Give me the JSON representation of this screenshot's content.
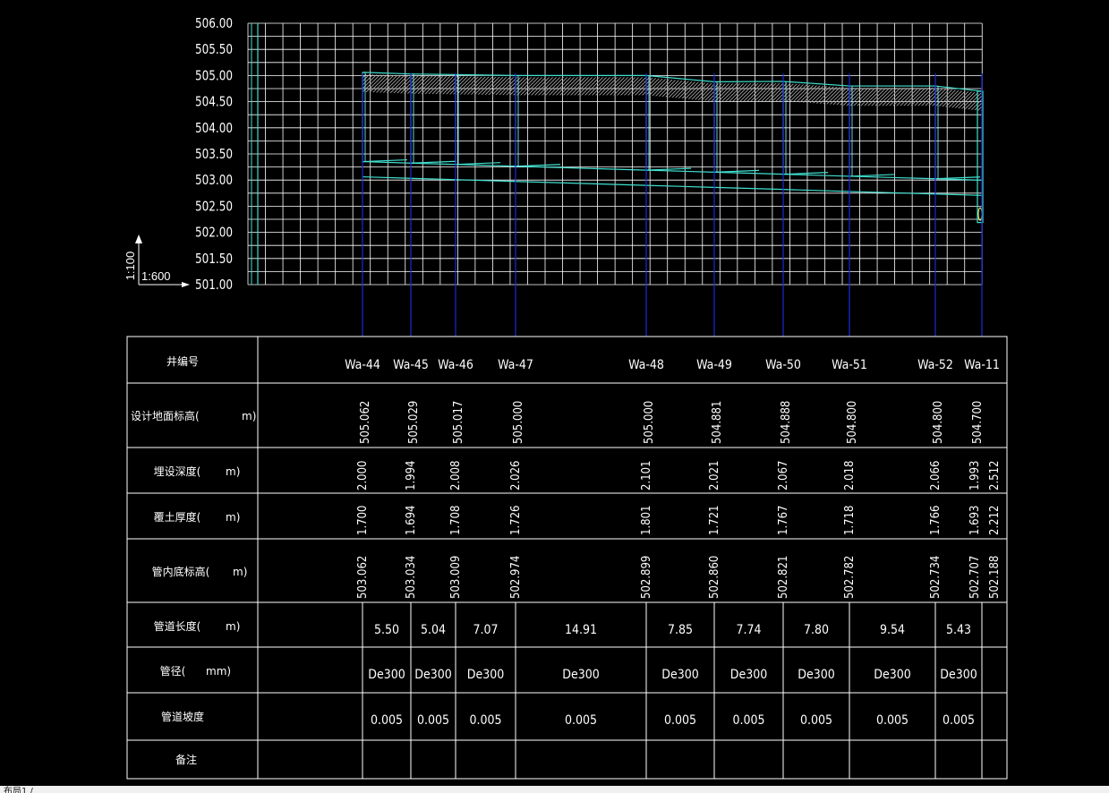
{
  "profile": {
    "y_axis": {
      "min": 501.0,
      "max": 506.0,
      "step": 0.5,
      "ticks": [
        "501.00",
        "501.50",
        "502.00",
        "502.50",
        "503.00",
        "503.50",
        "504.00",
        "504.50",
        "505.00",
        "505.50",
        "506.00"
      ]
    },
    "scale_vertical": "1:100",
    "scale_horizontal": "1:600"
  },
  "wells": [
    {
      "id": "Wa-44",
      "ground": "505.062",
      "depth": "2.000",
      "cover": "1.700",
      "invert": "503.062"
    },
    {
      "id": "Wa-45",
      "ground": "505.029",
      "depth": "1.994",
      "cover": "1.694",
      "invert": "503.034"
    },
    {
      "id": "Wa-46",
      "ground": "505.017",
      "depth": "2.008",
      "cover": "1.708",
      "invert": "503.009"
    },
    {
      "id": "Wa-47",
      "ground": "505.000",
      "depth": "2.026",
      "cover": "1.726",
      "invert": "502.974"
    },
    {
      "id": "Wa-48",
      "ground": "505.000",
      "depth": "2.101",
      "cover": "1.801",
      "invert": "502.899"
    },
    {
      "id": "Wa-49",
      "ground": "504.881",
      "depth": "2.021",
      "cover": "1.721",
      "invert": "502.860"
    },
    {
      "id": "Wa-50",
      "ground": "504.888",
      "depth": "2.067",
      "cover": "1.767",
      "invert": "502.821"
    },
    {
      "id": "Wa-51",
      "ground": "504.800",
      "depth": "2.018",
      "cover": "1.718",
      "invert": "502.782"
    },
    {
      "id": "Wa-52",
      "ground": "504.800",
      "depth": "2.066",
      "cover": "1.766",
      "invert": "502.734"
    },
    {
      "id": "Wa-11",
      "ground": "504.700",
      "depth": "1.993",
      "cover": "1.693",
      "invert": "502.707",
      "depth2": "2.512",
      "cover2": "2.212",
      "invert2": "502.188"
    }
  ],
  "segments": [
    {
      "length": "5.50",
      "diameter": "De300",
      "slope": "0.005"
    },
    {
      "length": "5.04",
      "diameter": "De300",
      "slope": "0.005"
    },
    {
      "length": "7.07",
      "diameter": "De300",
      "slope": "0.005"
    },
    {
      "length": "14.91",
      "diameter": "De300",
      "slope": "0.005"
    },
    {
      "length": "7.85",
      "diameter": "De300",
      "slope": "0.005"
    },
    {
      "length": "7.74",
      "diameter": "De300",
      "slope": "0.005"
    },
    {
      "length": "7.80",
      "diameter": "De300",
      "slope": "0.005"
    },
    {
      "length": "9.54",
      "diameter": "De300",
      "slope": "0.005"
    },
    {
      "length": "5.43",
      "diameter": "De300",
      "slope": "0.005"
    }
  ],
  "row_labels": {
    "well_no": "井编号",
    "ground": "设计地面标高(",
    "depth": "埋设深度(",
    "cover": "覆土厚度(",
    "invert": "管内底标高(",
    "length": "管道长度(",
    "diameter": "管径(",
    "slope": "管道坡度",
    "remark": "备注",
    "unit_m": "m)",
    "unit_mm": "mm)"
  },
  "colors": {
    "grid": "#ffffff",
    "pipe": "#40e0d0",
    "well_line": "#1c2ad8",
    "table": "#ffffff"
  },
  "status": "布局1 /"
}
